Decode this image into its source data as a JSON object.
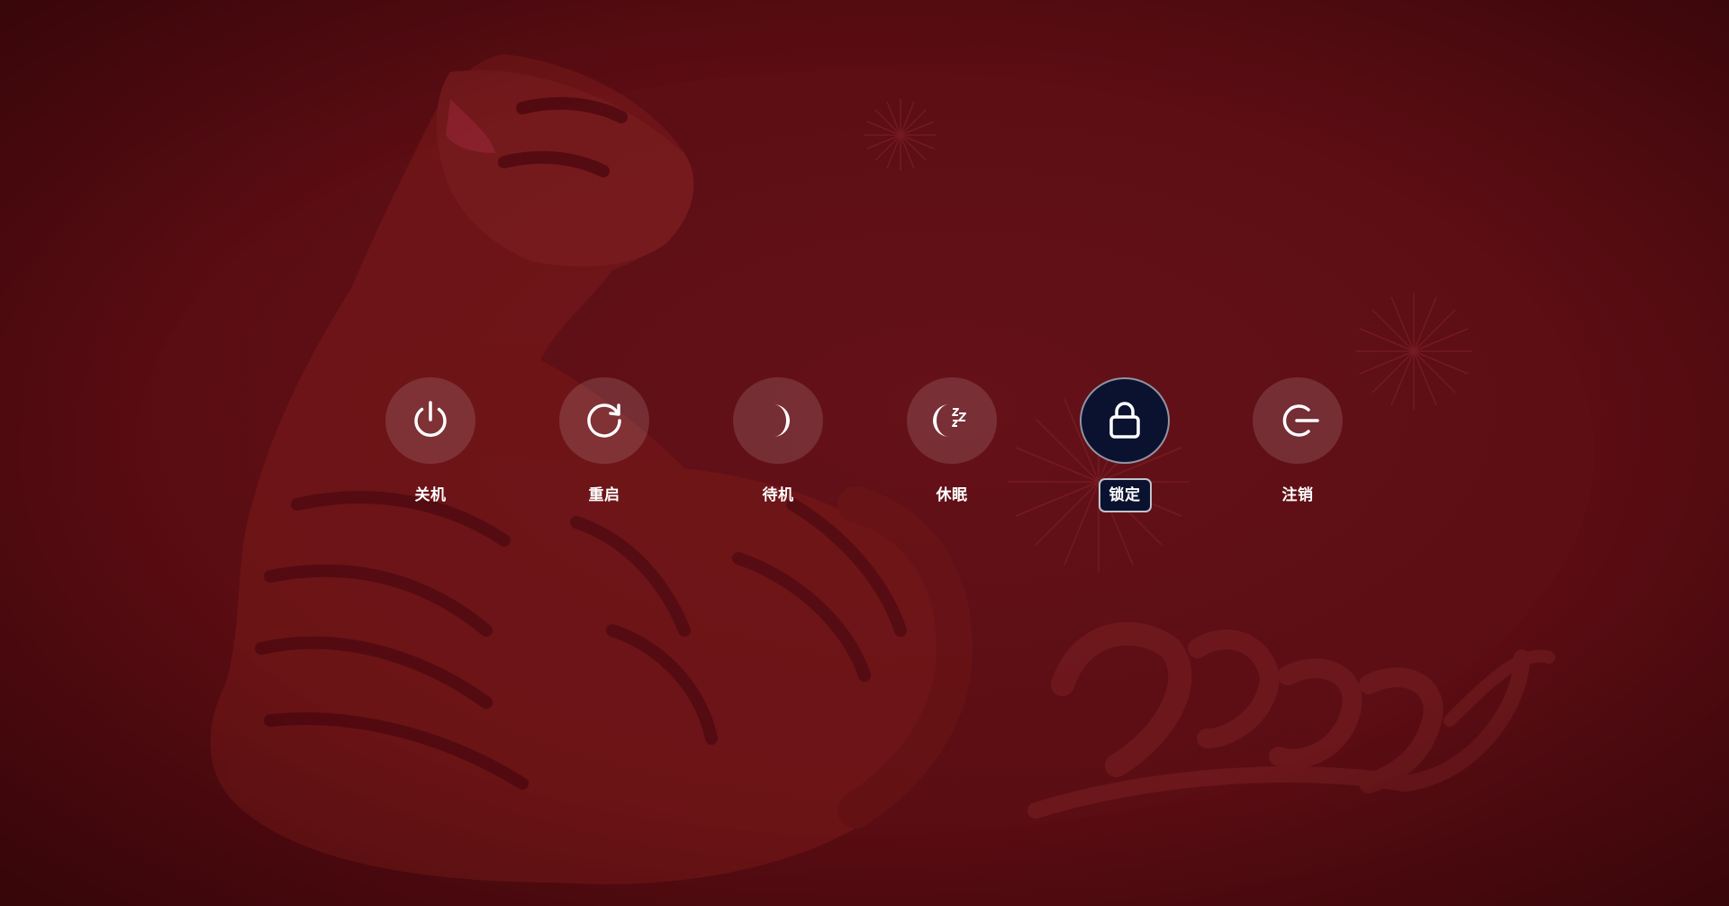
{
  "power_menu": {
    "items": [
      {
        "id": "shutdown",
        "label": "关机",
        "icon": "power-icon"
      },
      {
        "id": "reboot",
        "label": "重启",
        "icon": "reboot-icon"
      },
      {
        "id": "suspend",
        "label": "待机",
        "icon": "moon-icon"
      },
      {
        "id": "hibernate",
        "label": "休眠",
        "icon": "moon-zzz-icon"
      },
      {
        "id": "lock",
        "label": "锁定",
        "icon": "lock-icon",
        "selected": true
      },
      {
        "id": "logout",
        "label": "注销",
        "icon": "logout-icon"
      }
    ]
  },
  "wallpaper": {
    "subject": "tiger-wallpaper",
    "colors": {
      "background": "#5a0c12",
      "accent_dark": "#0b1230"
    }
  }
}
